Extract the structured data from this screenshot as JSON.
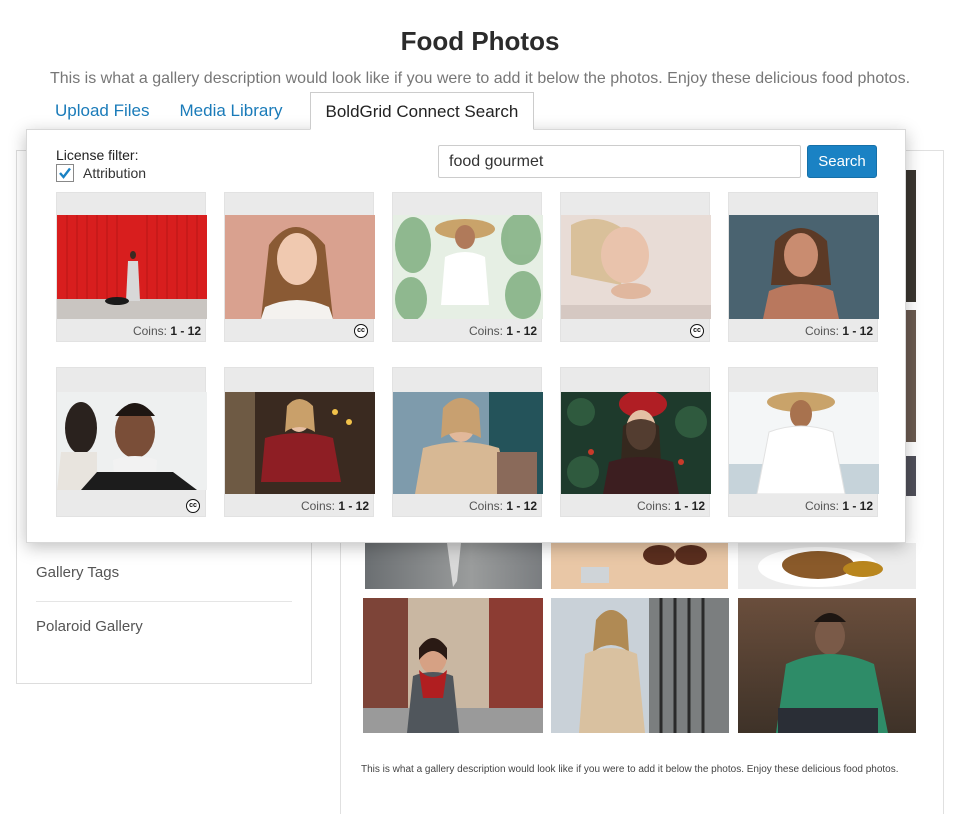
{
  "page": {
    "title": "Food Photos",
    "description": "This is what a gallery description would look like if you were to add it below the photos. Enjoy these delicious food photos."
  },
  "tabs": [
    {
      "label": "Upload Files",
      "active": false
    },
    {
      "label": "Media Library",
      "active": false
    },
    {
      "label": "BoldGrid Connect Search",
      "active": true
    }
  ],
  "background": {
    "sidebar_links": [
      "Gallery Tags",
      "Polaroid Gallery"
    ],
    "gallery_description": "This is what a gallery description would look like if you were to add it below the photos. Enjoy these delicious food photos."
  },
  "search": {
    "license_filter_label": "License filter:",
    "attribution_label": "Attribution",
    "attribution_checked": true,
    "query": "food gourmet",
    "button_label": "Search"
  },
  "results": [
    {
      "coins_label": "Coins:",
      "coins_range": "1 - 12",
      "attribution": false
    },
    {
      "coins_label": "",
      "coins_range": "",
      "attribution": true
    },
    {
      "coins_label": "Coins:",
      "coins_range": "1 - 12",
      "attribution": false
    },
    {
      "coins_label": "",
      "coins_range": "",
      "attribution": true
    },
    {
      "coins_label": "Coins:",
      "coins_range": "1 - 12",
      "attribution": false
    },
    {
      "coins_label": "",
      "coins_range": "",
      "attribution": true
    },
    {
      "coins_label": "Coins:",
      "coins_range": "1 - 12",
      "attribution": false
    },
    {
      "coins_label": "Coins:",
      "coins_range": "1 - 12",
      "attribution": false
    },
    {
      "coins_label": "Coins:",
      "coins_range": "1 - 12",
      "attribution": false
    },
    {
      "coins_label": "Coins:",
      "coins_range": "1 - 12",
      "attribution": false
    }
  ],
  "colors": {
    "accent": "#1a82c4",
    "link": "#1a7bb9"
  }
}
